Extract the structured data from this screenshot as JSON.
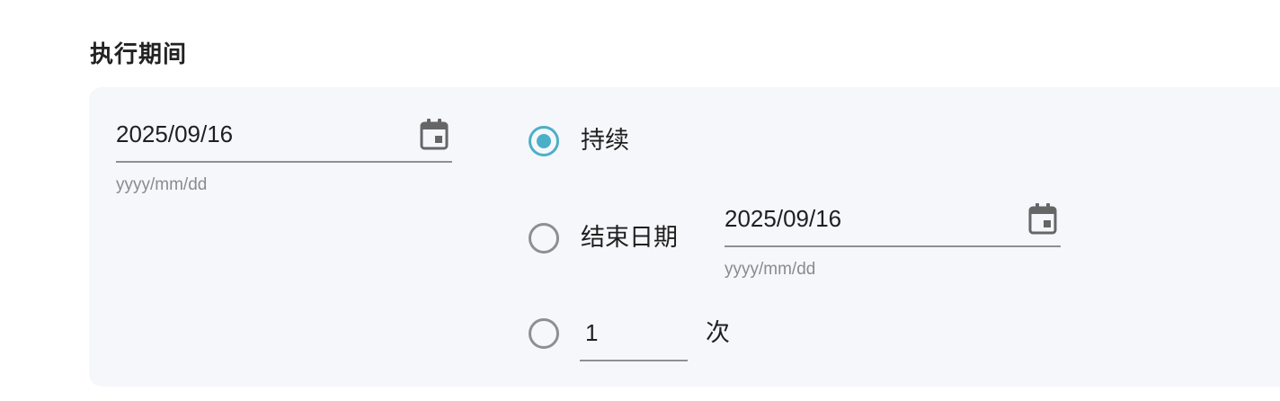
{
  "section": {
    "title": "执行期间"
  },
  "start_date": {
    "value": "2025/09/16",
    "hint": "yyyy/mm/dd",
    "icon": "calendar-icon"
  },
  "options": {
    "continuous_label": "持续",
    "end_date_label": "结束日期",
    "count_unit": "次",
    "selected": "continuous"
  },
  "end_date": {
    "value": "2025/09/16",
    "hint": "yyyy/mm/dd",
    "icon": "calendar-icon"
  },
  "count": {
    "value": "1"
  },
  "colors": {
    "accent": "#4bb0c7",
    "panel_bg": "#f6f7fb"
  }
}
